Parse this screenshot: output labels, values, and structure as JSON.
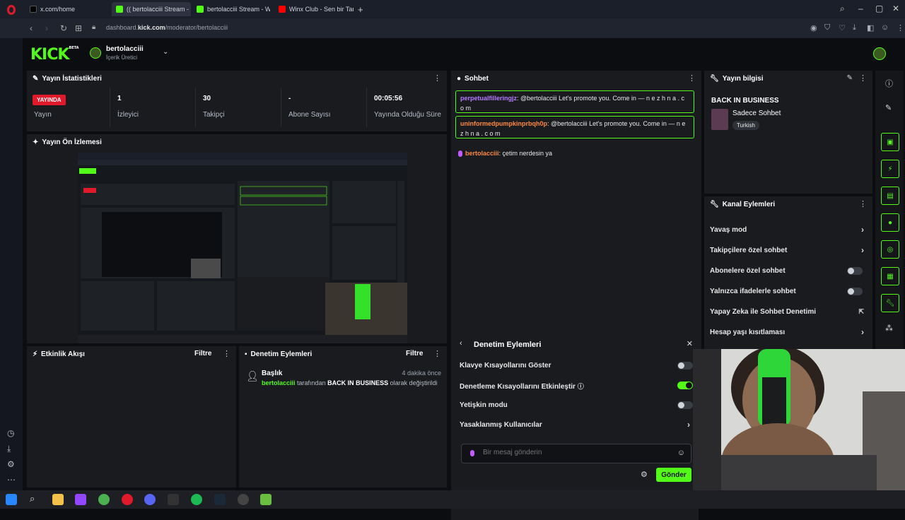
{
  "browser": {
    "tabs": [
      {
        "label": "x.com/home"
      },
      {
        "label": "(( bertolacciii Stream - K"
      },
      {
        "label": "bertolacciii Stream - Wat"
      },
      {
        "label": "Winx Club - Sen bir Tanesi"
      }
    ],
    "url_prefix": "dashboard.",
    "url_host": "kick.com",
    "url_path": "/moderator/bertolacciii"
  },
  "header": {
    "logo": "KICK",
    "logo_tag": "BETA",
    "user_name": "bertolacciii",
    "user_role": "İçerik Üretici"
  },
  "stats": {
    "title": "Yayın İstatistikleri",
    "live_badge": "YAYINDA",
    "items": [
      {
        "value": "",
        "label": "Yayın"
      },
      {
        "value": "1",
        "label": "İzleyici"
      },
      {
        "value": "30",
        "label": "Takipçi"
      },
      {
        "value": "-",
        "label": "Abone Sayısı"
      },
      {
        "value": "00:05:56",
        "label": "Yayında Olduğu Süre"
      }
    ]
  },
  "preview": {
    "title": "Yayın Ön İzlemesi"
  },
  "activity": {
    "title": "Etkinlik Akışı",
    "filter": "Filtre"
  },
  "mod_actions": {
    "title": "Denetim Eylemleri",
    "filter": "Filtre",
    "entry": {
      "kind": "Başlık",
      "time": "4 dakika önce",
      "user": "bertolacciii",
      "text1": "tarafından",
      "value": "BACK IN BUSINESS",
      "text2": "olarak değiştirildi"
    }
  },
  "chat": {
    "title": "Sohbet",
    "messages": [
      {
        "user": "perpetualfilleringjz",
        "text": ": @bertolacciii Let's promote you. Come in — n e z h n a . c o m"
      },
      {
        "user": "uninformedpumpkinprbqh0p",
        "text": ": @bertolacciii Let's promote you. Come in — n e z h n a . c o m"
      },
      {
        "user": "bertolacciii",
        "text": ": çetim nerdesin ya"
      }
    ],
    "input_placeholder": "Bir mesaj gönderin",
    "send": "Gönder"
  },
  "mod_overlay": {
    "title": "Denetim Eylemleri",
    "rows": [
      {
        "label": "Klavye Kısayollarını Göster",
        "on": false
      },
      {
        "label": "Denetleme Kısayollarını Etkinleştir",
        "on": true
      },
      {
        "label": "Yetişkin modu",
        "on": false
      },
      {
        "label": "Yasaklanmış Kullanıcılar"
      }
    ]
  },
  "stream_info": {
    "title": "Yayın bilgisi",
    "stream_title": "BACK IN BUSINESS",
    "category": "Sadece Sohbet",
    "tag": "Turkish"
  },
  "channel_actions": {
    "title": "Kanal Eylemleri",
    "rows": [
      {
        "label": "Yavaş mod",
        "type": "chevron"
      },
      {
        "label": "Takipçilere özel sohbet",
        "type": "chevron"
      },
      {
        "label": "Abonelere özel sohbet",
        "type": "toggle",
        "on": false
      },
      {
        "label": "Yalnızca ifadelerle sohbet",
        "type": "toggle",
        "on": false
      },
      {
        "label": "Yapay Zeka ile Sohbet Denetimi",
        "type": "external"
      },
      {
        "label": "Hesap yaşı kısıtlaması",
        "type": "chevron"
      }
    ]
  },
  "colors": {
    "kick_green": "#53fc18",
    "live_red": "#e0192b",
    "panel": "#191b1f"
  }
}
